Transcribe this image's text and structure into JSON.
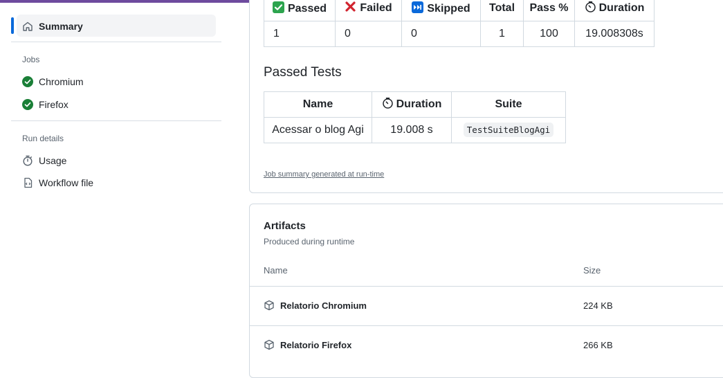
{
  "sidebar": {
    "summary_label": "Summary",
    "jobs_heading": "Jobs",
    "jobs": [
      {
        "label": "Chromium",
        "status": "success"
      },
      {
        "label": "Firefox",
        "status": "success"
      }
    ],
    "run_details_heading": "Run details",
    "details": [
      {
        "label": "Usage",
        "icon": "stopwatch-icon"
      },
      {
        "label": "Workflow file",
        "icon": "file-code-icon"
      }
    ]
  },
  "results_table": {
    "headers": [
      "Passed",
      "Failed",
      "Skipped",
      "Total",
      "Pass %",
      "Duration"
    ],
    "header_icons": [
      "check-mark-icon",
      "cross-mark-icon",
      "fast-forward-icon",
      "",
      "",
      "stopwatch-icon"
    ],
    "row": [
      "1",
      "0",
      "0",
      "1",
      "100",
      "19.008308s"
    ]
  },
  "passed_tests": {
    "heading": "Passed Tests",
    "headers": [
      "Name",
      "Duration",
      "Suite"
    ],
    "rows": [
      {
        "name": "Acessar o blog Agi",
        "duration": "19.008 s",
        "suite": "TestSuiteBlogAgi"
      }
    ]
  },
  "summary_footer": "Job summary generated at run-time",
  "artifacts": {
    "title": "Artifacts",
    "subtitle": "Produced during runtime",
    "col_name": "Name",
    "col_size": "Size",
    "items": [
      {
        "name": "Relatorio Chromium",
        "size": "224 KB"
      },
      {
        "name": "Relatorio Firefox",
        "size": "266 KB"
      }
    ]
  },
  "colors": {
    "accent": "#0969da",
    "success": "#1a7f37",
    "topbar": "#6e4b9e"
  }
}
